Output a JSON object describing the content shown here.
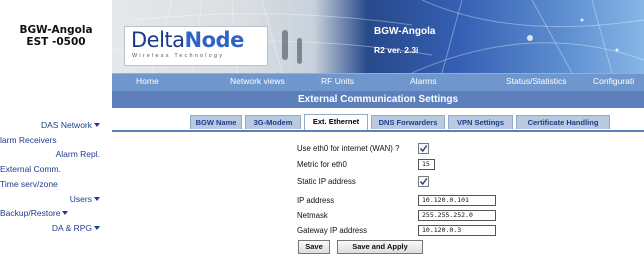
{
  "site": {
    "name": "BGW-Angola",
    "timezone": "EST -0500"
  },
  "left_nav": [
    {
      "label": "DAS Network",
      "has_menu": true,
      "align": "right"
    },
    {
      "label": "larm Receivers",
      "has_menu": false,
      "align": "left"
    },
    {
      "label": "Alarm Repl.",
      "has_menu": false,
      "align": "right"
    },
    {
      "label": "External Comm.",
      "has_menu": false,
      "align": "left"
    },
    {
      "label": "Time serv/zone",
      "has_menu": false,
      "align": "left"
    },
    {
      "label": "Users",
      "has_menu": true,
      "align": "right"
    },
    {
      "label": "Backup/Restore",
      "has_menu": true,
      "align": "left"
    },
    {
      "label": "DA & RPG",
      "has_menu": true,
      "align": "right"
    }
  ],
  "banner": {
    "logo": "DeltaNode",
    "logo_tagline": "Wireless Technology",
    "device_name": "BGW-Angola",
    "version": "R2 ver. 2.3i"
  },
  "top_nav": [
    "Home",
    "Network views",
    "RF Units",
    "Alarms",
    "Status/Statistics",
    "Configurati"
  ],
  "page_title": "External Communication Settings",
  "tabs": [
    {
      "label": "BGW Name",
      "active": false
    },
    {
      "label": "3G-Modem",
      "active": false
    },
    {
      "label": "Ext. Ethernet",
      "active": true
    },
    {
      "label": "DNS Forwarders",
      "active": false
    },
    {
      "label": "VPN Settings",
      "active": false
    },
    {
      "label": "Certificate Handling",
      "active": false
    }
  ],
  "form": {
    "use_eth0": {
      "label": "Use eth0 for internet (WAN) ?",
      "checked": true
    },
    "metric": {
      "label": "Metric for eth0",
      "value": "15"
    },
    "static_ip": {
      "label": "Static IP address",
      "checked": true
    },
    "ip_address": {
      "label": "IP address",
      "value": "10.120.0.101"
    },
    "netmask": {
      "label": "Netmask",
      "value": "255.255.252.0"
    },
    "gateway": {
      "label": "Gateway IP address",
      "value": "10.120.0.3"
    }
  },
  "buttons": {
    "save": "Save",
    "save_apply": "Save and Apply"
  },
  "colors": {
    "nav_bar": "#6f97cd",
    "title_bar": "#5d80bc",
    "tab_bg": "#b9c9e0",
    "link": "#1d3e8c"
  }
}
